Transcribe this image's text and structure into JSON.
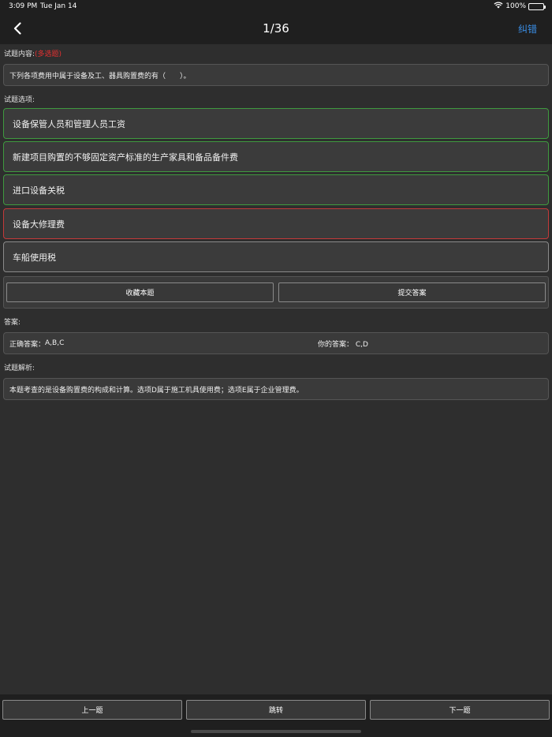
{
  "status_bar": {
    "time": "3:09 PM",
    "date": "Tue Jan 14",
    "battery": "100%"
  },
  "nav": {
    "title": "1/36",
    "report_label": "纠错"
  },
  "question": {
    "section_label": "试题内容:",
    "type_tag": "(多选题)",
    "text": "下列各项费用中属于设备及工、器具购置费的有（　　）。"
  },
  "options_section": {
    "label": "试题选项:",
    "items": [
      {
        "text": "设备保管人员和管理人员工资",
        "state": "correct"
      },
      {
        "text": "新建项目购置的不够固定资产标准的生产家具和备品备件费",
        "state": "correct"
      },
      {
        "text": "进口设备关税",
        "state": "correct"
      },
      {
        "text": "设备大修理费",
        "state": "wrong"
      },
      {
        "text": "车船使用税",
        "state": "plain"
      }
    ]
  },
  "actions": {
    "favorite_label": "收藏本题",
    "submit_label": "提交答案"
  },
  "answer": {
    "section_label": "答案:",
    "correct_label": "正确答案：",
    "correct_value": "A,B,C",
    "yours_label": "你的答案：",
    "yours_value": "C,D"
  },
  "analysis": {
    "section_label": "试题解析:",
    "text": "本题考查的是设备购置费的构成和计算。选项D属于施工机具使用费；选项E属于企业管理费。"
  },
  "footer": {
    "prev_label": "上一题",
    "jump_label": "跳转",
    "next_label": "下一题"
  },
  "colors": {
    "correct_border": "#3f9a3f",
    "wrong_border": "#c23a3a",
    "link_blue": "#3a8ee6",
    "accent_red": "#e53030"
  }
}
